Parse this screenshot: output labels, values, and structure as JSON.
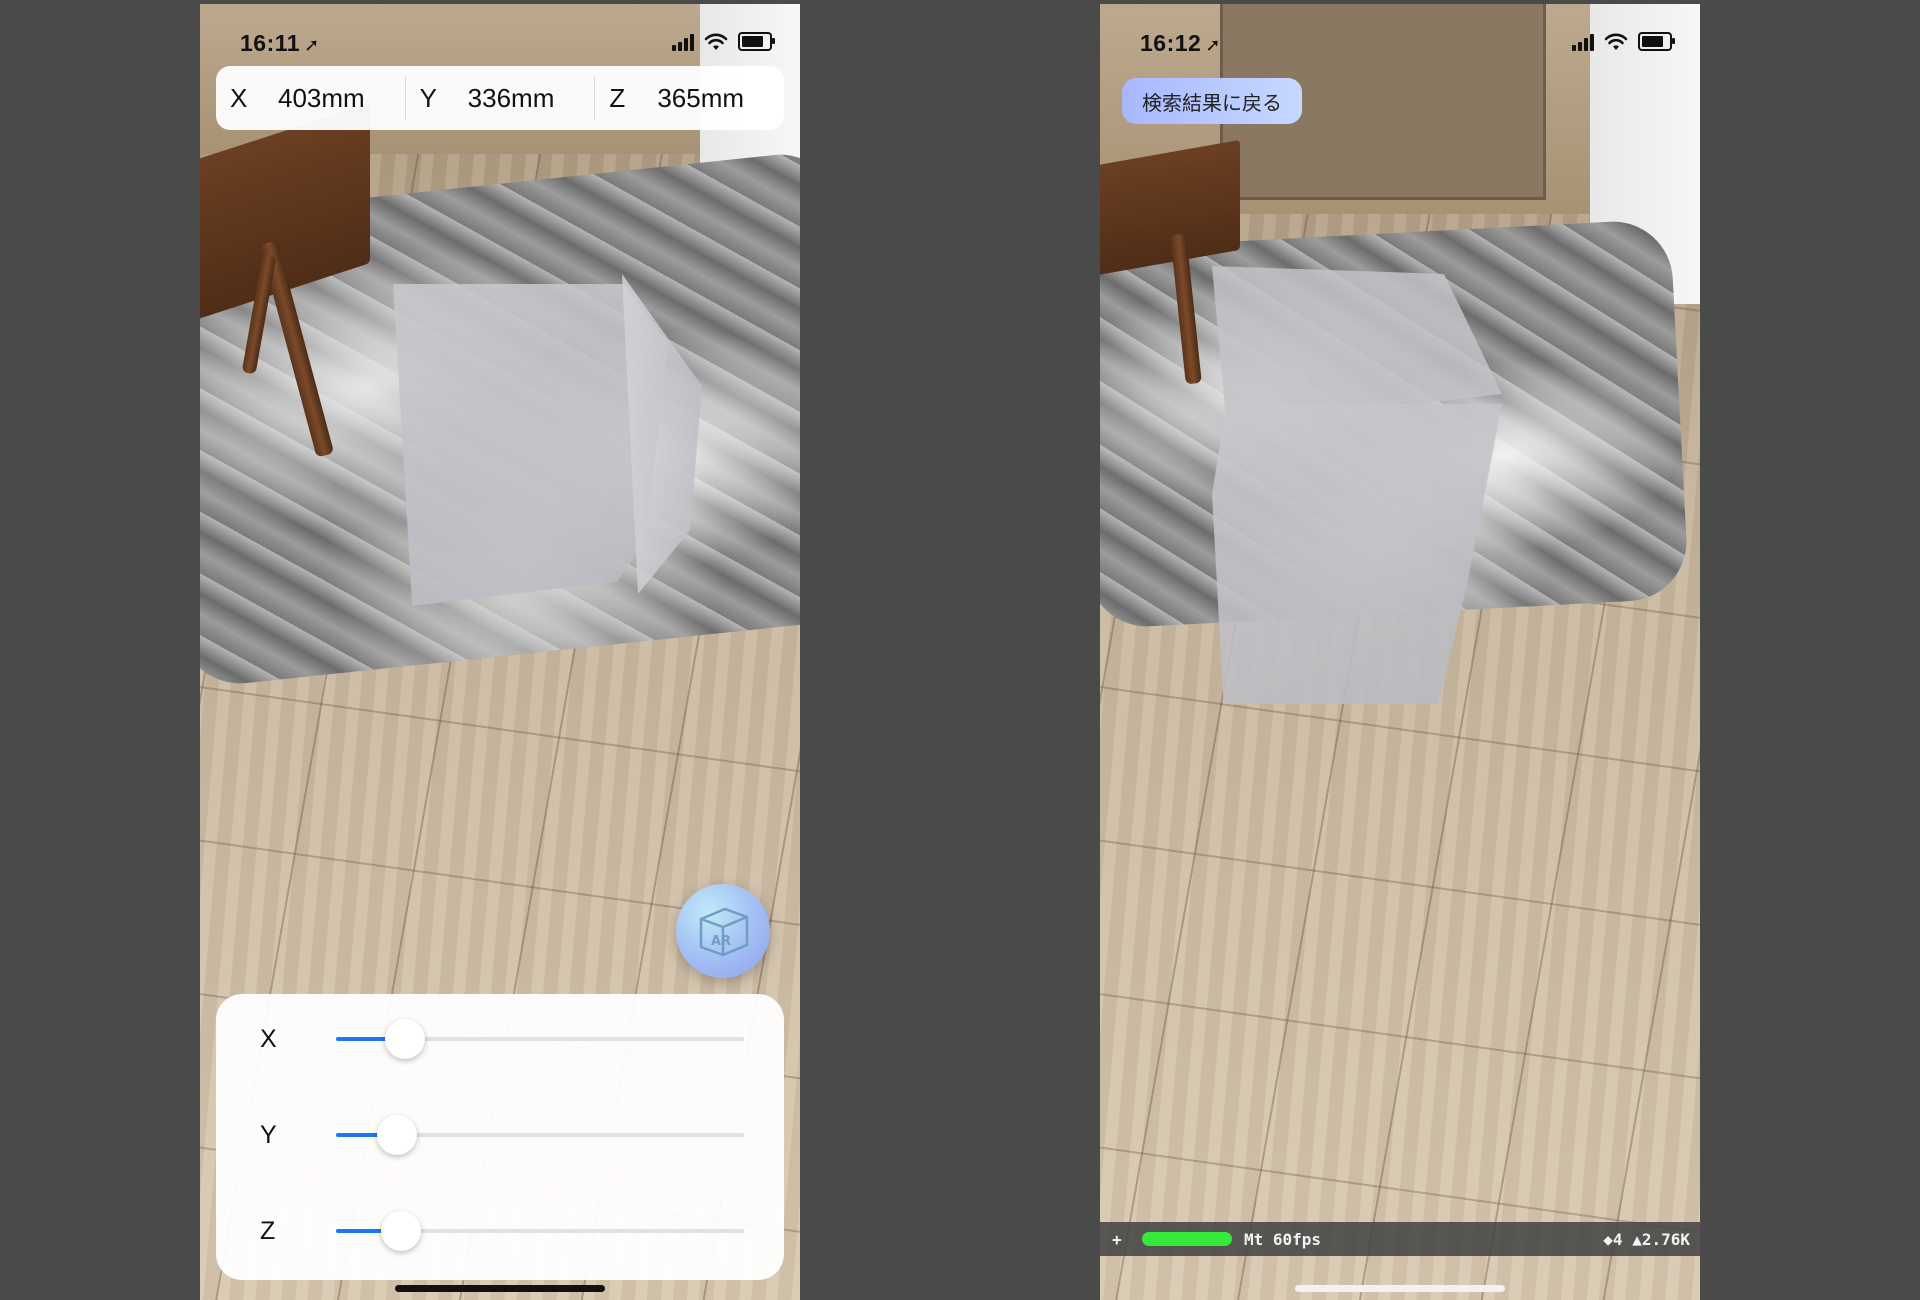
{
  "left_screen": {
    "status": {
      "time": "16:11"
    },
    "dimensions": [
      {
        "axis": "X",
        "value": "403mm"
      },
      {
        "axis": "Y",
        "value": "336mm"
      },
      {
        "axis": "Z",
        "value": "365mm"
      }
    ],
    "ar_button": {
      "label": "AR"
    },
    "sliders": [
      {
        "label": "X",
        "level": 0.17
      },
      {
        "label": "Y",
        "level": 0.15
      },
      {
        "label": "Z",
        "level": 0.16
      }
    ]
  },
  "right_screen": {
    "status": {
      "time": "16:12"
    },
    "back_button": {
      "label": "検索結果に戻る"
    },
    "stats": {
      "plus": "+",
      "fps": "Mt 60fps",
      "counts": "◆4 ▲2.76K",
      "meter_color": "#35e83a"
    }
  },
  "icons": [
    "location-arrow-icon",
    "cellular-signal-icon",
    "wifi-icon",
    "battery-icon",
    "ar-cube-icon"
  ],
  "colors": {
    "accent": "#1a78f0",
    "background": "#4a4a4a"
  }
}
